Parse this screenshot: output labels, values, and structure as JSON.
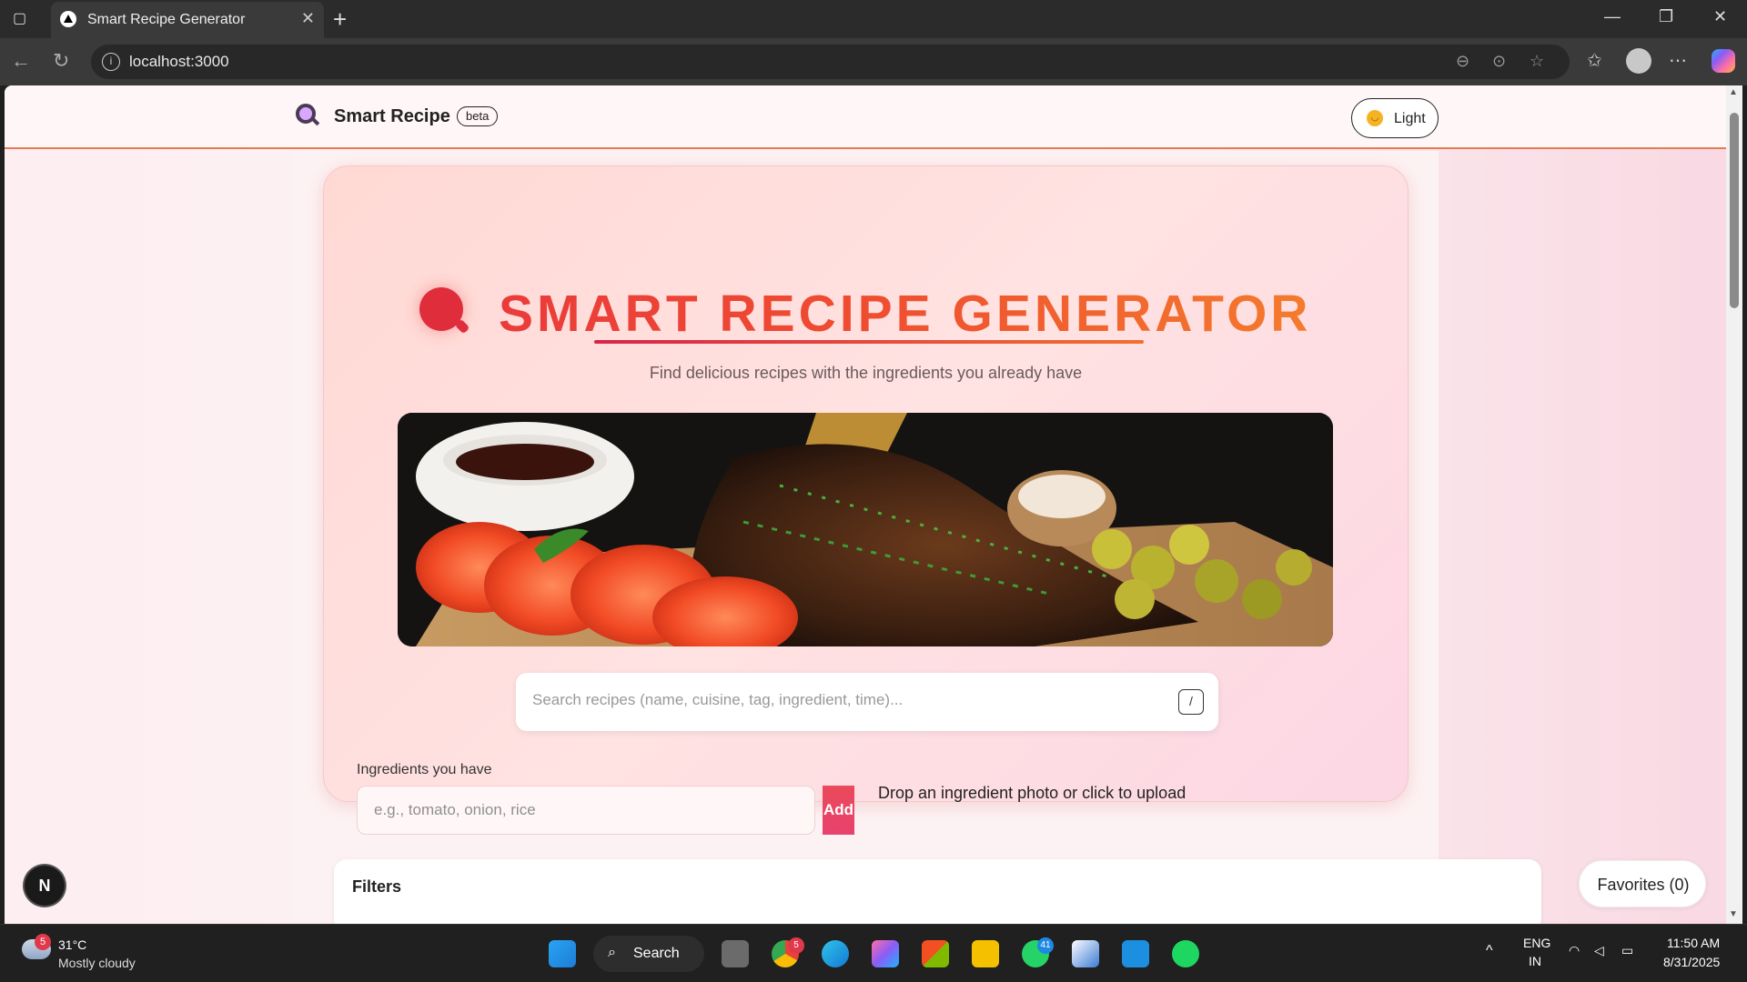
{
  "browser": {
    "tab_title": "Smart Recipe Generator",
    "tab_close": "✕",
    "new_tab": "+",
    "url": "localhost:3000",
    "window_controls": {
      "minimize": "—",
      "restore": "❐",
      "close": "✕"
    }
  },
  "header": {
    "brand": "Smart Recipe",
    "badge": "beta",
    "theme_toggle": "Light"
  },
  "hero": {
    "title": "SMART RECIPE GENERATOR",
    "subtitle": "Find delicious recipes with the ingredients you already have"
  },
  "search": {
    "placeholder": "Search recipes (name, cuisine, tag, ingredient, time)...",
    "shortcut_key": "/"
  },
  "ingredients": {
    "label": "Ingredients you have",
    "placeholder": "e.g., tomato, onion, rice",
    "add_button": "Add",
    "upload_prompt": "Drop an ingredient photo or click to upload"
  },
  "filters": {
    "title": "Filters"
  },
  "favorites": {
    "label": "Favorites (0)"
  },
  "dev_badge": "N",
  "taskbar": {
    "weather_badge": "5",
    "temperature": "31°C",
    "weather": "Mostly cloudy",
    "search_label": "Search",
    "chrome_badge": "5",
    "whatsapp_badge": "41",
    "language": "ENG",
    "region": "IN",
    "time": "11:50 AM",
    "date": "8/31/2025"
  },
  "colors": {
    "title_gradient_start": "#ea3b3b",
    "title_gradient_end": "#f47b2d",
    "add_button": "#ea4a5a",
    "header_border": "#e57a52"
  }
}
